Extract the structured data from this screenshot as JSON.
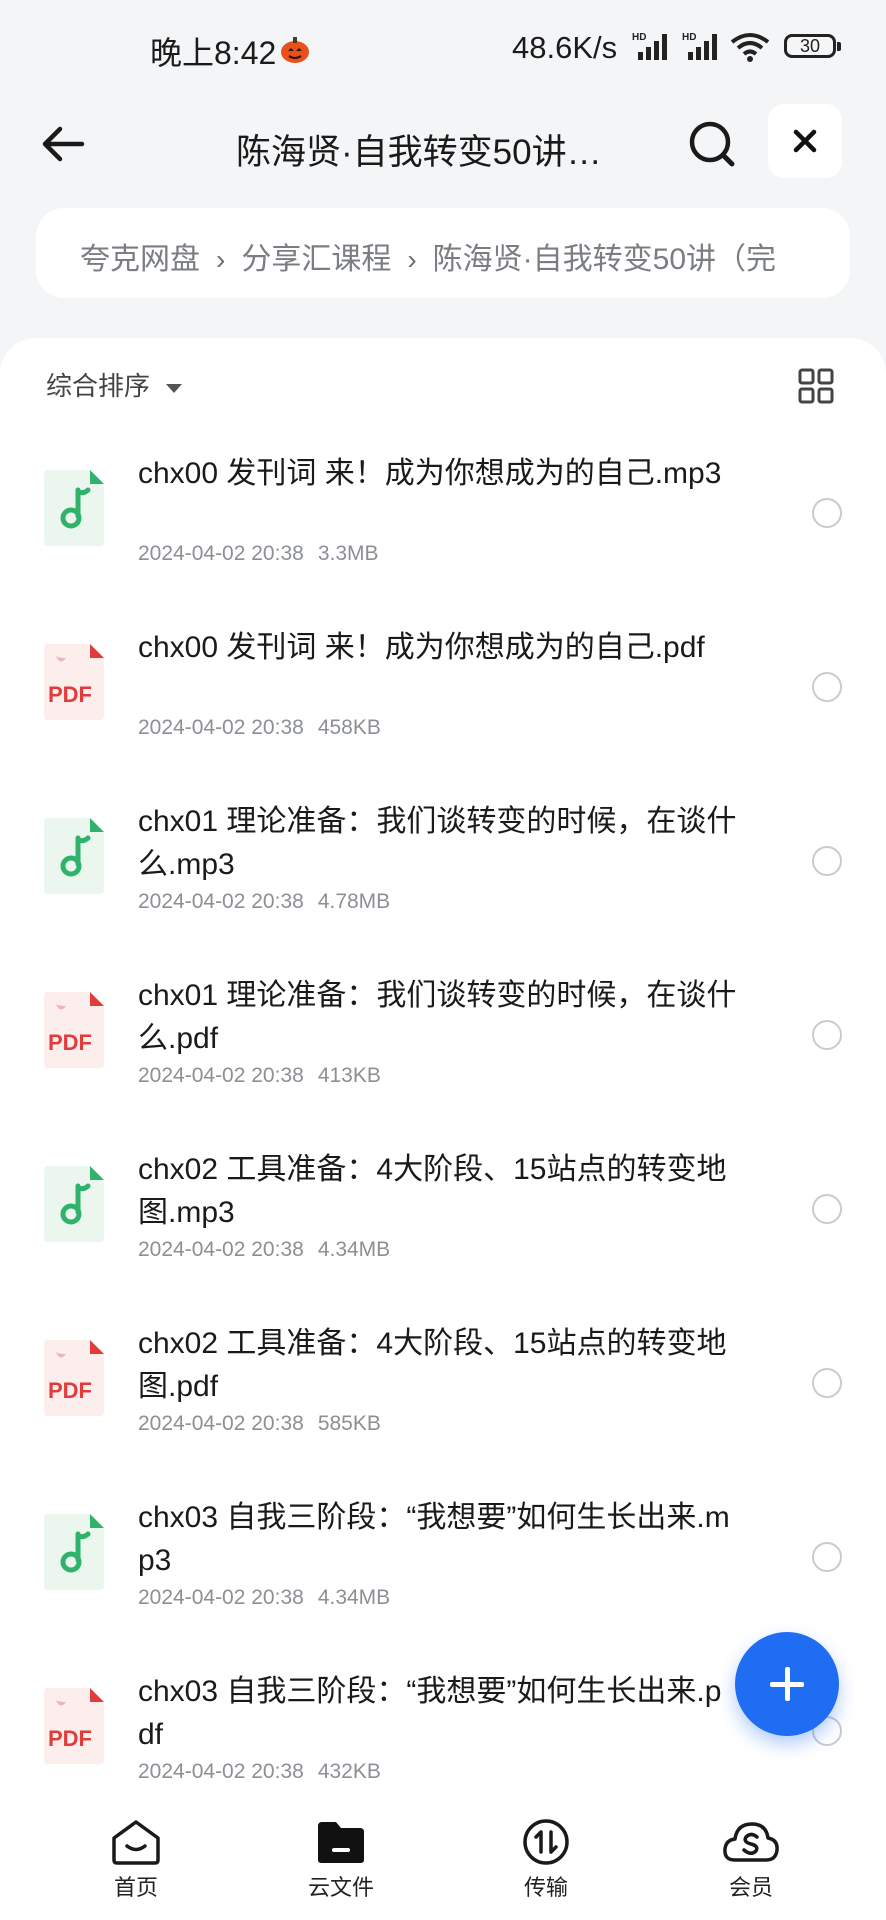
{
  "status_bar": {
    "time": "晚上8:42",
    "speed": "48.6K/s",
    "signal_label": "HD",
    "battery": "30"
  },
  "header": {
    "title": "陈海贤·自我转变50讲…"
  },
  "breadcrumb": [
    "夸克网盘",
    "分享汇课程",
    "陈海贤·自我转变50讲（完"
  ],
  "breadcrumb_separator": "›",
  "toolbar": {
    "sort_label": "综合排序"
  },
  "files": [
    {
      "name": "chx00 发刊词 来！成为你想成为的自己.mp3",
      "type": "audio",
      "date": "2024-04-02 20:38",
      "size": "3.3MB"
    },
    {
      "name": "chx00 发刊词 来！成为你想成为的自己.pdf",
      "type": "pdf",
      "date": "2024-04-02 20:38",
      "size": "458KB"
    },
    {
      "name": "chx01 理论准备：我们谈转变的时候，在谈什么.mp3",
      "type": "audio",
      "date": "2024-04-02 20:38",
      "size": "4.78MB"
    },
    {
      "name": "chx01 理论准备：我们谈转变的时候，在谈什么.pdf",
      "type": "pdf",
      "date": "2024-04-02 20:38",
      "size": "413KB"
    },
    {
      "name": "chx02 工具准备：4大阶段、15站点的转变地图.mp3",
      "type": "audio",
      "date": "2024-04-02 20:38",
      "size": "4.34MB"
    },
    {
      "name": "chx02 工具准备：4大阶段、15站点的转变地图.pdf",
      "type": "pdf",
      "date": "2024-04-02 20:38",
      "size": "585KB"
    },
    {
      "name": "chx03 自我三阶段：“我想要”如何生长出来.mp3",
      "type": "audio",
      "date": "2024-04-02 20:38",
      "size": "4.34MB"
    },
    {
      "name": "chx03 自我三阶段：“我想要”如何生长出来.pdf",
      "type": "pdf",
      "date": "2024-04-02 20:38",
      "size": "432KB"
    }
  ],
  "pdf_icon_text": "PDF",
  "bottom_nav": [
    {
      "label": "首页",
      "icon": "home-icon"
    },
    {
      "label": "云文件",
      "icon": "folder-icon"
    },
    {
      "label": "传输",
      "icon": "transfer-icon"
    },
    {
      "label": "会员",
      "icon": "member-icon"
    }
  ],
  "colors": {
    "accent": "#1f6df2",
    "audio_icon": "#2fb36b",
    "pdf_icon": "#e23b3b"
  }
}
